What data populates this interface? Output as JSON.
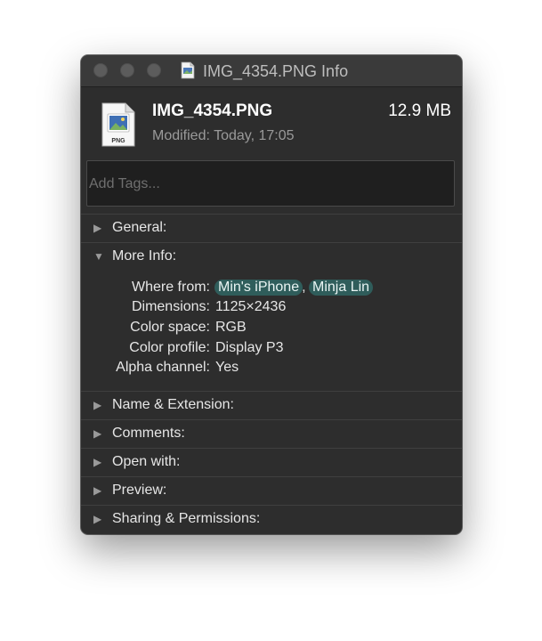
{
  "window": {
    "title": "IMG_4354.PNG Info"
  },
  "file": {
    "name": "IMG_4354.PNG",
    "size": "12.9 MB",
    "modified": "Modified: Today, 17:05",
    "icon_label": "PNG"
  },
  "tags": {
    "placeholder": "Add Tags..."
  },
  "sections": {
    "general": "General:",
    "more_info": "More Info:",
    "name_extension": "Name & Extension:",
    "comments": "Comments:",
    "open_with": "Open with:",
    "preview": "Preview:",
    "sharing": "Sharing & Permissions:"
  },
  "more_info": {
    "where_from_label": "Where from:",
    "where_from_values": [
      "Min's iPhone",
      "Minja Lin"
    ],
    "where_from_separator": ",",
    "dimensions_label": "Dimensions:",
    "dimensions_value": "1125×2436",
    "color_space_label": "Color space:",
    "color_space_value": "RGB",
    "color_profile_label": "Color profile:",
    "color_profile_value": "Display P3",
    "alpha_label": "Alpha channel:",
    "alpha_value": "Yes"
  },
  "icons": {
    "collapsed": "▶",
    "expanded": "▼"
  },
  "colors": {
    "window_bg": "#2d2d2d",
    "titlebar_bg": "#3a3a3a",
    "chip_bg": "#2f5d5b",
    "text": "#e6e6e6",
    "secondary_text": "#9a9a9a"
  }
}
